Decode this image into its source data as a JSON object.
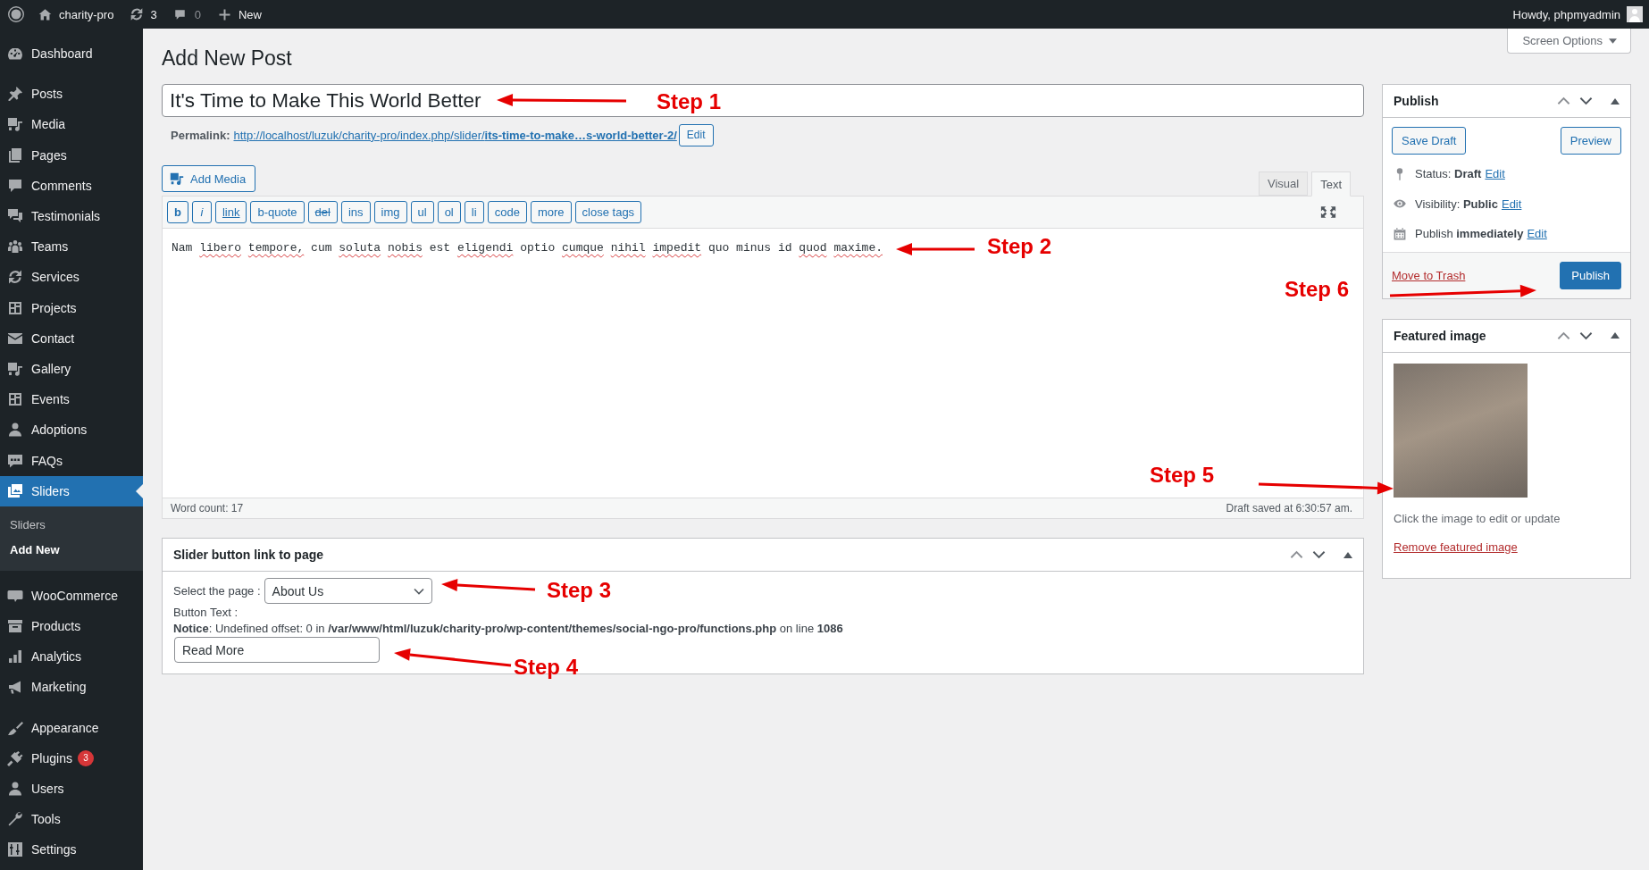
{
  "admin_bar": {
    "site_name": "charity-pro",
    "updates": "3",
    "comments": "0",
    "new_label": "New",
    "greeting": "Howdy, phpmyadmin"
  },
  "sidebar": {
    "groups": [
      [
        {
          "label": "Dashboard",
          "selected": false
        }
      ],
      [
        {
          "label": "Posts",
          "selected": false
        },
        {
          "label": "Media",
          "selected": false
        },
        {
          "label": "Pages",
          "selected": false
        },
        {
          "label": "Comments",
          "selected": false
        },
        {
          "label": "Testimonials",
          "selected": false
        },
        {
          "label": "Teams",
          "selected": false
        },
        {
          "label": "Services",
          "selected": false
        },
        {
          "label": "Projects",
          "selected": false
        },
        {
          "label": "Contact",
          "selected": false
        },
        {
          "label": "Gallery",
          "selected": false
        },
        {
          "label": "Events",
          "selected": false
        },
        {
          "label": "Adoptions",
          "selected": false
        },
        {
          "label": "FAQs",
          "selected": false
        },
        {
          "label": "Sliders",
          "selected": true,
          "children": [
            {
              "label": "Sliders",
              "selected": false
            },
            {
              "label": "Add New",
              "selected": true
            }
          ]
        }
      ],
      [
        {
          "label": "WooCommerce",
          "selected": false
        },
        {
          "label": "Products",
          "selected": false
        },
        {
          "label": "Analytics",
          "selected": false
        },
        {
          "label": "Marketing",
          "selected": false
        }
      ],
      [
        {
          "label": "Appearance",
          "selected": false
        },
        {
          "label": "Plugins",
          "selected": false,
          "badge": "3"
        },
        {
          "label": "Users",
          "selected": false
        },
        {
          "label": "Tools",
          "selected": false
        },
        {
          "label": "Settings",
          "selected": false
        }
      ]
    ]
  },
  "screen_options": "Screen Options",
  "page_title": "Add New Post",
  "title_field": {
    "value": "It's Time to Make This World Better"
  },
  "permalink": {
    "label": "Permalink:",
    "url": "http://localhost/luzuk/charity-pro/index.php/slider/**its-time-to-make…s-world-better-2/**",
    "edit_button": "Edit"
  },
  "add_media_button": "Add Media",
  "editor_tabs": [
    {
      "label": "Visual",
      "selected": false
    },
    {
      "label": "Text",
      "selected": true
    }
  ],
  "toolbar": [
    {
      "label": "b",
      "kind": "bold"
    },
    {
      "label": "i",
      "kind": "italic"
    },
    {
      "label": "link",
      "kind": "underline"
    },
    {
      "label": "b-quote",
      "kind": "plain"
    },
    {
      "label": "del",
      "kind": "strike"
    },
    {
      "label": "ins",
      "kind": "plain"
    },
    {
      "label": "img",
      "kind": "plain"
    },
    {
      "label": "ul",
      "kind": "plain"
    },
    {
      "label": "ol",
      "kind": "plain"
    },
    {
      "label": "li",
      "kind": "plain"
    },
    {
      "label": "code",
      "kind": "plain"
    },
    {
      "label": "more",
      "kind": "plain"
    },
    {
      "label": "close tags",
      "kind": "plain"
    }
  ],
  "editor": {
    "tokens": [
      {
        "text": "Nam",
        "misspelled": false
      },
      {
        "text": "libero",
        "misspelled": true
      },
      {
        "text": "tempore,",
        "misspelled": true
      },
      {
        "text": "cum",
        "misspelled": false
      },
      {
        "text": "soluta",
        "misspelled": true
      },
      {
        "text": "nobis",
        "misspelled": true
      },
      {
        "text": "est",
        "misspelled": false
      },
      {
        "text": "eligendi",
        "misspelled": true
      },
      {
        "text": "optio",
        "misspelled": false
      },
      {
        "text": "cumque",
        "misspelled": true
      },
      {
        "text": "nihil",
        "misspelled": true
      },
      {
        "text": "impedit",
        "misspelled": true
      },
      {
        "text": "quo minus id",
        "misspelled": false
      },
      {
        "text": "quod",
        "misspelled": true
      },
      {
        "text": "maxime.",
        "misspelled": true
      }
    ],
    "word_count": "Word count: 17",
    "draft_status": "Draft saved at 6:30:57 am."
  },
  "slider_panel": {
    "title": "Slider button link to page",
    "select_label": "Select the page :",
    "selected_page": "About Us",
    "button_text_label": "Button Text :",
    "notice": "**Notice**: Undefined offset: 0 in **/var/www/html/luzuk/charity-pro/wp-content/themes/social-ngo-pro/functions.php** on line **1086**",
    "button_text_value": "Read More"
  },
  "publish_panel": {
    "title": "Publish",
    "save_draft": "Save Draft",
    "preview": "Preview",
    "rows": [
      {
        "kind": "status",
        "text": "Status: **Draft**",
        "link": "Edit"
      },
      {
        "kind": "visibility",
        "text": "Visibility: **Public**",
        "link": "Edit"
      },
      {
        "kind": "schedule",
        "text": "Publish **immediately**",
        "link": "Edit"
      }
    ],
    "trash_link": "Move to Trash",
    "publish_button": "Publish"
  },
  "featured_image_panel": {
    "title": "Featured image",
    "hint": "Click the image to edit or update",
    "remove_link": "Remove featured image"
  },
  "annotations": [
    {
      "label": "Step 1"
    },
    {
      "label": "Step 2"
    },
    {
      "label": "Step 3"
    },
    {
      "label": "Step 4"
    },
    {
      "label": "Step 5"
    },
    {
      "label": "Step 6"
    }
  ]
}
